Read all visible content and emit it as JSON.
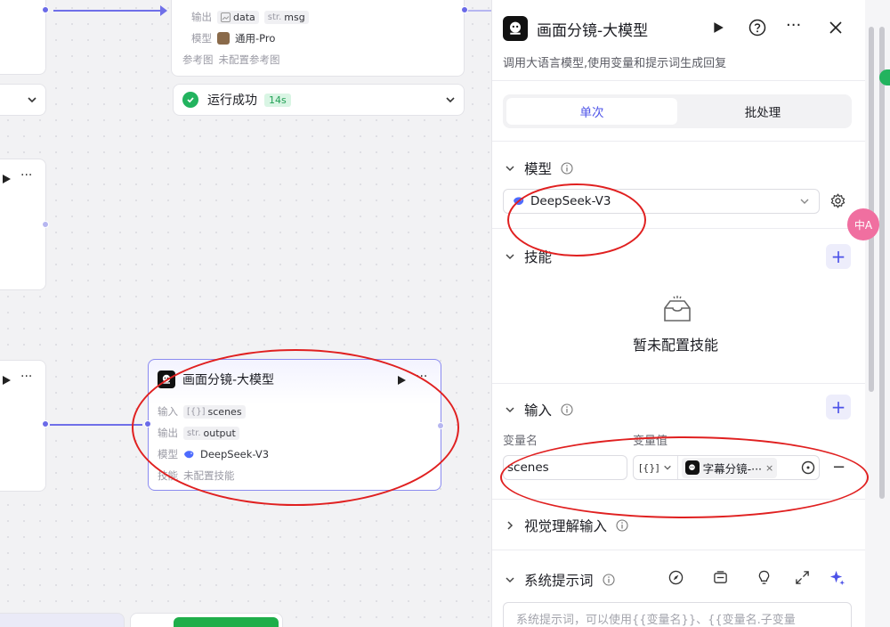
{
  "canvas": {
    "top_node": {
      "output_label": "输出",
      "output_tags": [
        {
          "type": "",
          "name": "data"
        },
        {
          "type": "str.",
          "name": "msg"
        }
      ],
      "model_label": "模型",
      "model_value": "通用-Pro",
      "ref_label": "参考图",
      "ref_value": "未配置参考图"
    },
    "run_status": {
      "text": "运行成功",
      "time": "14s"
    },
    "selected_node": {
      "title": "画面分镜-大模型",
      "input_label": "输入",
      "input_tag": {
        "type": "[{}]",
        "name": "scenes"
      },
      "output_label": "输出",
      "output_tag": {
        "type": "str.",
        "name": "output"
      },
      "model_label": "模型",
      "model_value": "DeepSeek-V3",
      "skill_label": "技能",
      "skill_value": "未配置技能"
    }
  },
  "panel": {
    "title": "画面分镜-大模型",
    "description": "调用大语言模型,使用变量和提示词生成回复",
    "tabs": [
      {
        "label": "单次",
        "active": true
      },
      {
        "label": "批处理",
        "active": false
      }
    ],
    "model_section": {
      "title": "模型",
      "selected": "DeepSeek-V3"
    },
    "skill_section": {
      "title": "技能",
      "empty_text": "暂未配置技能"
    },
    "input_section": {
      "title": "输入",
      "col_name": "变量名",
      "col_value": "变量值",
      "var_name": "scenes",
      "var_type": "[{}]",
      "var_ref": "字幕分镜-···"
    },
    "vision_section": {
      "title": "视觉理解输入"
    },
    "system_prompt": {
      "title": "系统提示词",
      "placeholder": "系统提示词，可以使用{{变量名}}、{{变量名.子变量"
    }
  },
  "floating": {
    "translate_label": "中A"
  },
  "colors": {
    "accent": "#4d53e8",
    "edge": "#6f6fe8",
    "success": "#22b35e",
    "annotation": "#e02020"
  }
}
